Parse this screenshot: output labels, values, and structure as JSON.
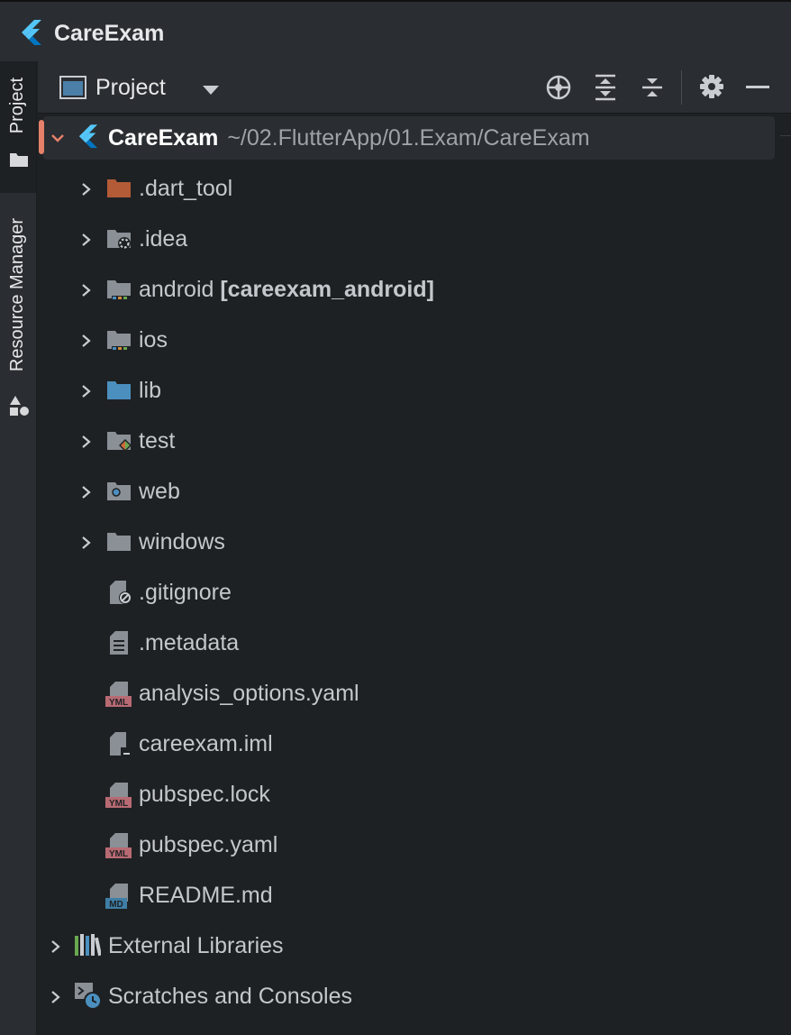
{
  "window": {
    "title": "CareExam"
  },
  "side_tabs": [
    {
      "label": "Project",
      "active": true
    },
    {
      "label": "Resource Manager",
      "active": false
    }
  ],
  "toolbar": {
    "view_label": "Project"
  },
  "root": {
    "name": "CareExam",
    "path": "~/02.FlutterApp/01.Exam/CareExam"
  },
  "items": [
    {
      "name": ".dart_tool",
      "icon": "folder-excluded-icon",
      "expandable": true
    },
    {
      "name": ".idea",
      "icon": "folder-config-icon",
      "expandable": true
    },
    {
      "name": "android",
      "module": "[careexam_android]",
      "icon": "folder-module-icon",
      "expandable": true
    },
    {
      "name": "ios",
      "icon": "folder-module-icon",
      "expandable": true
    },
    {
      "name": "lib",
      "icon": "folder-source-icon",
      "expandable": true
    },
    {
      "name": "test",
      "icon": "folder-test-icon",
      "expandable": true
    },
    {
      "name": "web",
      "icon": "folder-web-icon",
      "expandable": true
    },
    {
      "name": "windows",
      "icon": "folder-icon",
      "expandable": true
    },
    {
      "name": ".gitignore",
      "icon": "ignore-file-icon",
      "expandable": false
    },
    {
      "name": ".metadata",
      "icon": "text-file-icon",
      "expandable": false
    },
    {
      "name": "analysis_options.yaml",
      "icon": "yaml-file-icon",
      "expandable": false
    },
    {
      "name": "careexam.iml",
      "icon": "iml-file-icon",
      "expandable": false
    },
    {
      "name": "pubspec.lock",
      "icon": "yaml-file-icon",
      "expandable": false
    },
    {
      "name": "pubspec.yaml",
      "icon": "yaml-file-icon",
      "expandable": false
    },
    {
      "name": "README.md",
      "icon": "markdown-file-icon",
      "expandable": false
    }
  ],
  "bottom_items": [
    {
      "name": "External Libraries",
      "icon": "library-icon"
    },
    {
      "name": "Scratches and Consoles",
      "icon": "scratches-icon"
    }
  ],
  "icon_text": {
    "yml": "YML",
    "md": "MD"
  },
  "colors": {
    "accent_flutter": "#54c5f8",
    "folder": "#8a9096",
    "folder_excluded": "#b35a36",
    "folder_source": "#4b8fbf",
    "yml_badge": "#b86a73",
    "md_badge": "#3f7ea6",
    "selection_marker": "#e5806a"
  }
}
